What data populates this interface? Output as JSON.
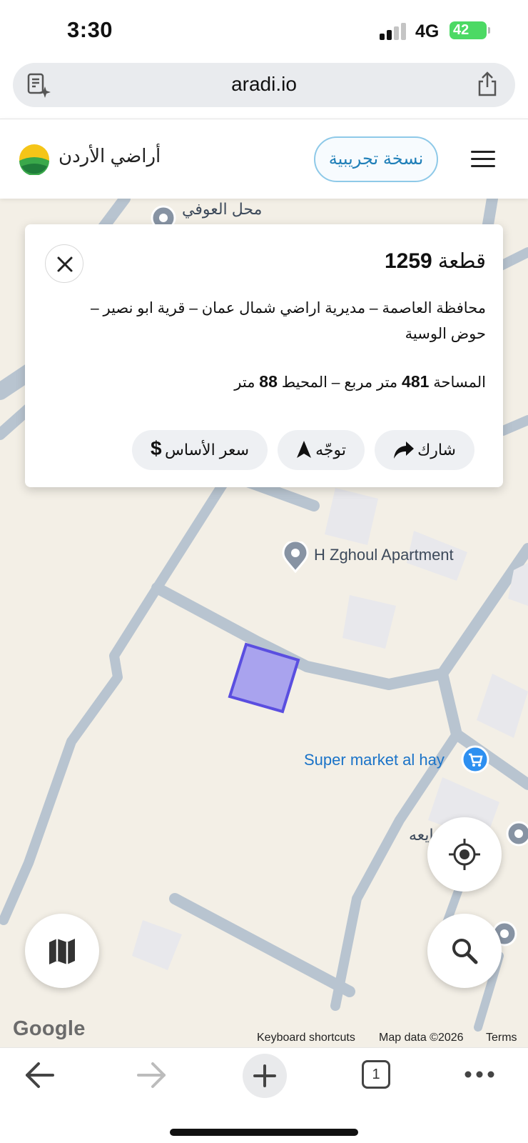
{
  "status_bar": {
    "time": "3:30",
    "network": "4G",
    "battery": "42"
  },
  "browser": {
    "url": "aradi.io",
    "left_icon": "reader-icon",
    "right_icon": "share-icon"
  },
  "app_header": {
    "brand": "أراضي الأردن",
    "beta_label": "نسخة تجريبية",
    "menu_icon": "hamburger-icon"
  },
  "parcel_card": {
    "title_label": "قطعة",
    "parcel_number": "1259",
    "location": "محافظة العاصمة – مديرية اراضي شمال عمان – قرية ابو نصير – حوض الوسية",
    "area_label": "المساحة",
    "area_value": "481",
    "area_unit": "متر مربع",
    "separator": "–",
    "perimeter_label": "المحيط",
    "perimeter_value": "88",
    "perimeter_unit": "متر",
    "actions": {
      "share": "شارك",
      "navigate": "توجّه",
      "base_price": "سعر الأساس"
    }
  },
  "map": {
    "pois": {
      "top": "محل العوفي",
      "apartment": "H Zghoul Apartment",
      "supermarket": "Super market al hay",
      "partial": "ايعه"
    },
    "google": "Google",
    "keyboard_shortcuts": "Keyboard shortcuts",
    "map_data": "Map data ©2026",
    "terms": "Terms",
    "parcel_color": "#a9a3ee",
    "parcel_stroke": "#5a4ee0",
    "road_color": "#b8c4d0"
  },
  "bottom_toolbar": {
    "tab_count": "1"
  }
}
